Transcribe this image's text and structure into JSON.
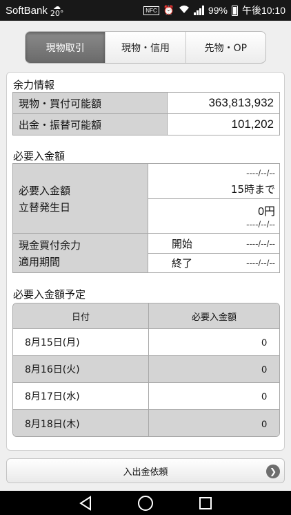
{
  "status_bar": {
    "carrier": "SoftBank",
    "weather_temp": "20°",
    "battery": "99%",
    "time": "午後10:10",
    "icons": [
      "weather-icon",
      "nfc-icon",
      "alarm-icon",
      "wifi-icon",
      "signal-icon",
      "battery-icon"
    ]
  },
  "tabs": [
    {
      "label": "現物取引",
      "active": true
    },
    {
      "label": "現物・信用",
      "active": false
    },
    {
      "label": "先物・OP",
      "active": false
    }
  ],
  "yoryoku": {
    "title": "余力情報",
    "rows": [
      {
        "label": "現物・買付可能額",
        "value": "363,813,932"
      },
      {
        "label": "出金・振替可能額",
        "value": "101,202"
      }
    ]
  },
  "hitsuyo": {
    "title": "必要入金額",
    "label_line1": "必要入金額",
    "label_line2": "立替発生日",
    "date1": "----/--/--",
    "deadline": "15時まで",
    "amount": "0円",
    "date2": "----/--/--",
    "period_label_line1": "現金買付余力",
    "period_label_line2": "適用期間",
    "start_label": "開始",
    "start_value": "----/--/--",
    "end_label": "終了",
    "end_value": "----/--/--"
  },
  "schedule": {
    "title": "必要入金額予定",
    "col_date": "日付",
    "col_amount": "必要入金額",
    "rows": [
      {
        "date": "8月15日(月)",
        "amount": "0"
      },
      {
        "date": "8月16日(火)",
        "amount": "0"
      },
      {
        "date": "8月17日(水)",
        "amount": "0"
      },
      {
        "date": "8月18日(木)",
        "amount": "0"
      }
    ]
  },
  "deposit_button": {
    "label": "入出金依頼"
  },
  "nav": [
    "back-icon",
    "home-icon",
    "recents-icon"
  ]
}
